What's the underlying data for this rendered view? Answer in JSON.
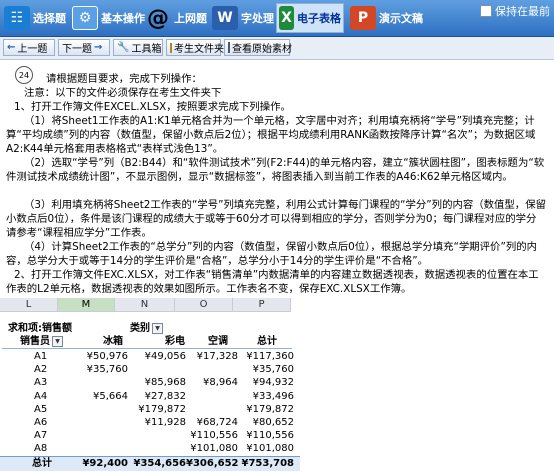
{
  "toolbar": {
    "items": [
      {
        "label": "选择题",
        "icon": "choice-icon",
        "color": "#1a7fd4"
      },
      {
        "label": "基本操作",
        "icon": "basic-op-icon",
        "color": "#5aa0e6"
      },
      {
        "label": "上网题",
        "icon": "internet-at-icon",
        "color": "#ffffff"
      },
      {
        "label": "字处理",
        "icon": "word-icon",
        "color": "#2b5fad"
      },
      {
        "label": "电子表格",
        "icon": "excel-icon",
        "color": "#1f8a3c"
      },
      {
        "label": "演示文稿",
        "icon": "ppt-icon",
        "color": "#d24726"
      }
    ],
    "keep_front_label": "保持在最前"
  },
  "nav": {
    "prev": "上一题",
    "next": "下一题",
    "toolbox": "工具箱",
    "exam_folder": "考生文件夹",
    "view_source": "查看原始素材"
  },
  "question": {
    "number": "24",
    "lines": [
      "请根据题目要求，完成下列操作：",
      "注意：以下的文件必须保存在考生文件夹下",
      "1、打开工作簿文件EXCEL.XLSX，按照要求完成下列操作。",
      "（1）将Sheet1工作表的A1:K1单元格合并为一个单元格，文字居中对齐；利用填充柄将“学号”列填充完整；计算“平均成绩”列的内容（数值型，保留小数点后2位）；根据平均成绩利用RANK函数按降序计算“名次”；为数据区域A2:K44单元格套用表格格式“表样式浅色13”。",
      "（2）选取“学号”列（B2:B44）和“软件测试技术”列(F2:F44)的单元格内容，建立“簇状圆柱图”，图表标题为“软件测试技术成绩统计图”，不显示图例，显示“数据标签”，将图表插入到当前工作表的A46:K62单元格区域内。",
      "（3）利用填充柄将Sheet2工作表的“学号”列填充完整，利用公式计算每门课程的“学分”列的内容（数值型，保留小数点后0位），条件是该门课程的成绩大于或等于60分才可以得到相应的学分，否则学分为0；每门课程对应的学分请参考“课程相应学分”工作表。",
      "（4）计算Sheet2工作表的“总学分”列的内容（数值型，保留小数点后0位），根据总学分填充“学期评价”列的内容，总学分大于或等于14分的学生评价是“合格”，总学分小于14分的学生评价是“不合格”。",
      "2、打开工作簿文件EXC.XLSX，对工作表“销售清单”内数据清单的内容建立数据透视表，数据透视表的位置在本工作表的L2单元格，数据透视表的效果如图所示。工作表名不变，保存EXC.XLSX工作簿。"
    ]
  },
  "pivot": {
    "columns": [
      "L",
      "M",
      "N",
      "O",
      "P"
    ],
    "selected_column": "M",
    "sum_label": "求和项:销售额",
    "category_label": "类别",
    "row_label": "销售员",
    "col_headers": [
      "冰箱",
      "彩电",
      "空调",
      "总计"
    ],
    "rows": [
      {
        "name": "A1",
        "vals": [
          "¥50,976",
          "¥49,056",
          "¥17,328",
          "¥117,360"
        ]
      },
      {
        "name": "A2",
        "vals": [
          "¥35,760",
          "",
          "",
          "¥35,760"
        ]
      },
      {
        "name": "A3",
        "vals": [
          "",
          "¥85,968",
          "¥8,964",
          "¥94,932"
        ]
      },
      {
        "name": "A4",
        "vals": [
          "¥5,664",
          "¥27,832",
          "",
          "¥33,496"
        ]
      },
      {
        "name": "A5",
        "vals": [
          "",
          "¥179,872",
          "",
          "¥179,872"
        ]
      },
      {
        "name": "A6",
        "vals": [
          "",
          "¥11,928",
          "¥68,724",
          "¥80,652"
        ]
      },
      {
        "name": "A7",
        "vals": [
          "",
          "",
          "¥110,556",
          "¥110,556"
        ]
      },
      {
        "name": "A8",
        "vals": [
          "",
          "",
          "¥101,080",
          "¥101,080"
        ]
      }
    ],
    "total": {
      "name": "总计",
      "vals": [
        "¥92,400",
        "¥354,656",
        "¥306,652",
        "¥753,708"
      ]
    }
  }
}
